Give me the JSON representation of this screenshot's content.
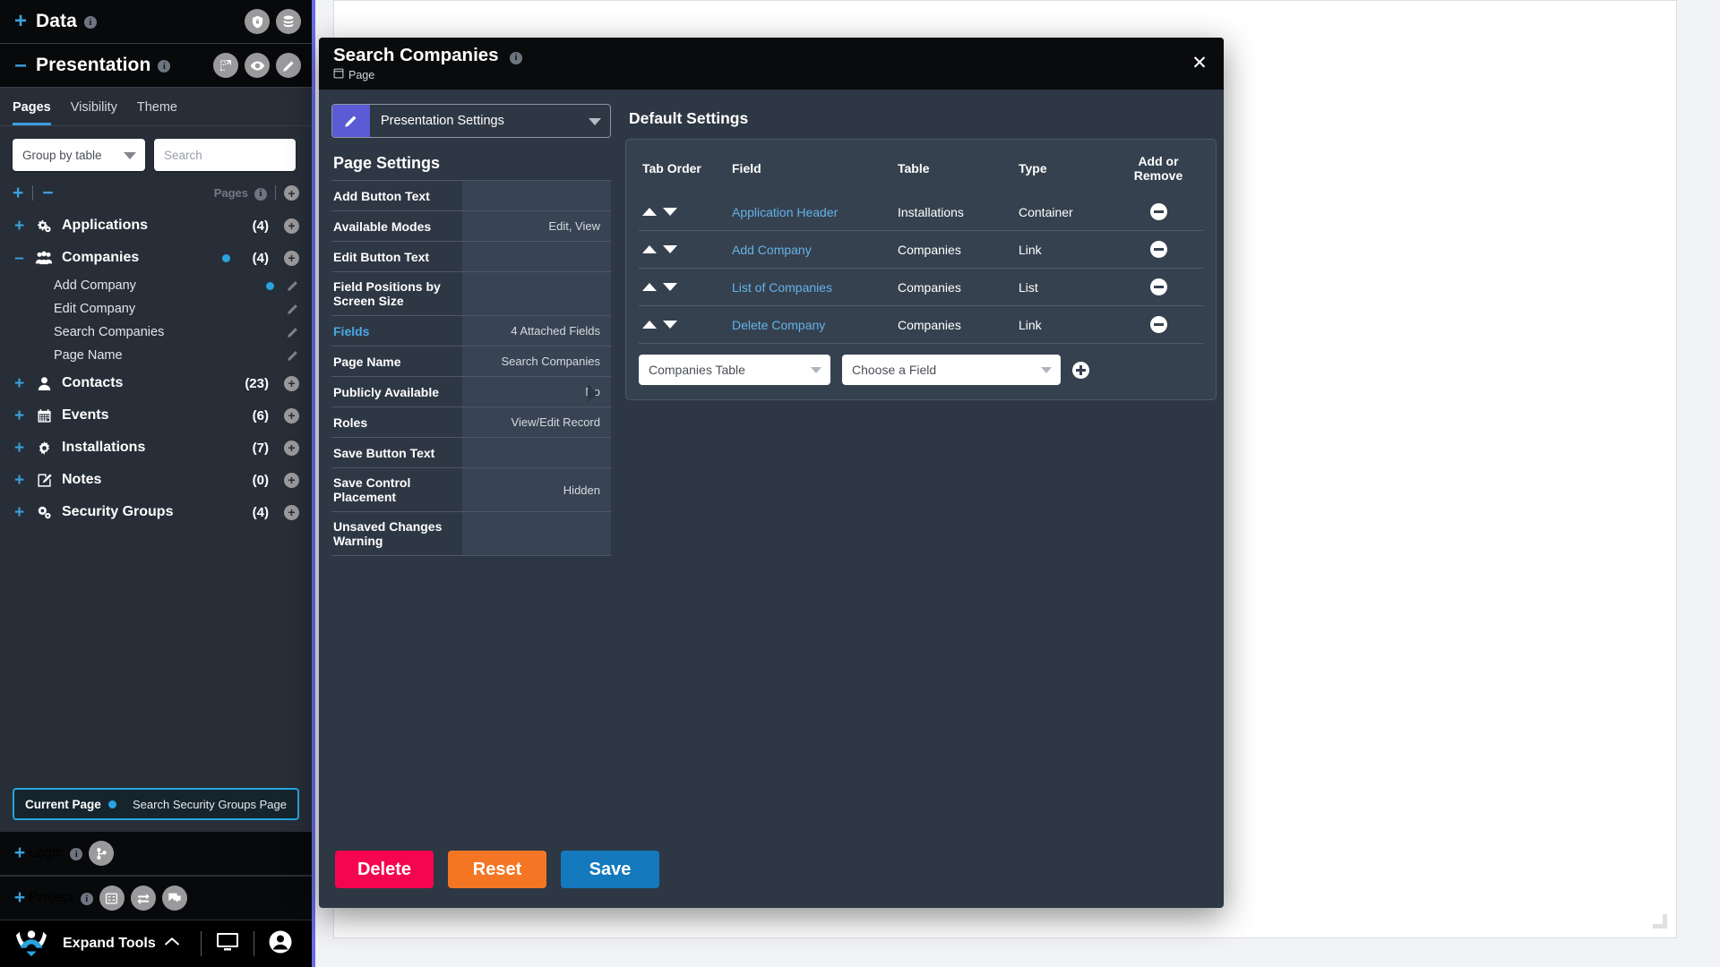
{
  "sidebar": {
    "sections": [
      {
        "label": "Data",
        "expander": "+",
        "icons": [
          "shield-lock-icon",
          "database-icon"
        ]
      },
      {
        "label": "Presentation",
        "expander": "–",
        "icons": [
          "resize-icon",
          "eye-icon",
          "pencil-icon"
        ]
      }
    ],
    "tabs": [
      {
        "label": "Pages",
        "active": true
      },
      {
        "label": "Visibility",
        "active": false
      },
      {
        "label": "Theme",
        "active": false
      }
    ],
    "group_by": "Group by table",
    "search_placeholder": "Search",
    "pages_label": "Pages",
    "tree": [
      {
        "label": "Applications",
        "icon": "gears-icon",
        "count": "(4)",
        "expander": "+",
        "children": []
      },
      {
        "label": "Companies",
        "icon": "people-icon",
        "count": "(4)",
        "expander": "–",
        "dot": true,
        "children": [
          {
            "label": "Add Company",
            "dot": true,
            "pencil": true
          },
          {
            "label": "Edit Company",
            "dot": false,
            "pencil": true
          },
          {
            "label": "Search Companies",
            "dot": false,
            "pencil": true
          },
          {
            "label": "Page Name",
            "dot": false,
            "pencil": true
          }
        ]
      },
      {
        "label": "Contacts",
        "icon": "person-icon",
        "count": "(23)",
        "expander": "+",
        "children": []
      },
      {
        "label": "Events",
        "icon": "calendar-icon",
        "count": "(6)",
        "expander": "+",
        "children": []
      },
      {
        "label": "Installations",
        "icon": "gear-icon",
        "count": "(7)",
        "expander": "+",
        "children": []
      },
      {
        "label": "Notes",
        "icon": "note-edit-icon",
        "count": "(0)",
        "expander": "+",
        "children": []
      },
      {
        "label": "Security Groups",
        "icon": "gears-icon",
        "count": "(4)",
        "expander": "+",
        "children": []
      }
    ],
    "current_page": {
      "title": "Current Page",
      "value": "Search Security Groups Page"
    },
    "logic_section": {
      "label": "Logic",
      "expander": "+",
      "icons": [
        "branch-icon"
      ]
    },
    "project_section": {
      "label": "Project",
      "expander": "+",
      "icons": [
        "flow-icon",
        "swap-icon",
        "chat-icon"
      ]
    },
    "taskbar": {
      "label": "Expand Tools",
      "chevron": "⌃",
      "icons": [
        "monitor-icon",
        "account-icon"
      ]
    }
  },
  "modal": {
    "title": "Search Companies",
    "subtitle": "Page",
    "close_label": "✕",
    "presentation_select": "Presentation Settings",
    "page_settings": {
      "title": "Page Settings",
      "rows": [
        {
          "key": "Add Button Text",
          "value": "",
          "link": false
        },
        {
          "key": "Available Modes",
          "value": "Edit, View",
          "link": false
        },
        {
          "key": "Edit Button Text",
          "value": "",
          "link": false
        },
        {
          "key": "Field Positions by Screen Size",
          "value": "",
          "link": false
        },
        {
          "key": "Fields",
          "value": "4 Attached Fields",
          "link": true
        },
        {
          "key": "Page Name",
          "value": "Search Companies",
          "link": false
        },
        {
          "key": "Publicly Available",
          "value": "No",
          "link": false
        },
        {
          "key": "Roles",
          "value": "View/Edit Record",
          "link": false
        },
        {
          "key": "Save Button Text",
          "value": "",
          "link": false
        },
        {
          "key": "Save Control Placement",
          "value": "Hidden",
          "link": false
        },
        {
          "key": "Unsaved Changes Warning",
          "value": "",
          "link": false
        }
      ]
    },
    "default_settings": {
      "title": "Default Settings",
      "columns": [
        "Tab Order",
        "Field",
        "Table",
        "Type",
        "Add or Remove"
      ],
      "rows": [
        {
          "field": "Application Header",
          "table": "Installations",
          "type": "Container"
        },
        {
          "field": "Add Company",
          "table": "Companies",
          "type": "Link"
        },
        {
          "field": "List of Companies",
          "table": "Companies",
          "type": "List"
        },
        {
          "field": "Delete Company",
          "table": "Companies",
          "type": "Link"
        }
      ],
      "adder": {
        "table_select": "Companies Table",
        "field_select": "Choose a Field"
      }
    },
    "buttons": {
      "delete": "Delete",
      "reset": "Reset",
      "save": "Save"
    }
  },
  "colors": {
    "accent_blue": "#29a3e0",
    "purple_rail": "#6c6ce8",
    "delete_red": "#f5054f",
    "reset_orange": "#f47625",
    "save_blue": "#1479bd",
    "panel_bg": "#2e3744",
    "sidebar_bg": "#272e38"
  }
}
